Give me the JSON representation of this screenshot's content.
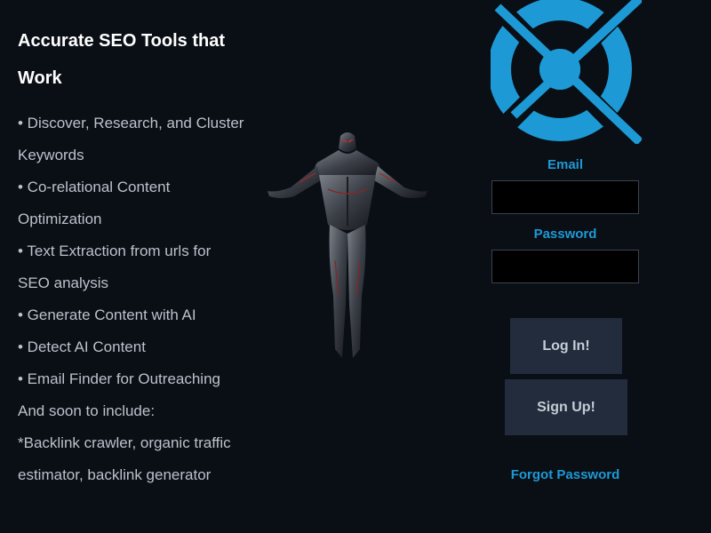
{
  "headline": "Accurate SEO Tools that Work",
  "features": [
    "• Discover, Research, and Cluster Keywords",
    "• Co-relational Content Optimization",
    "• Text Extraction from urls for SEO analysis",
    "• Generate Content with AI",
    "• Detect AI Content",
    "• Email Finder for Outreaching",
    "And soon to include:",
    "*Backlink crawler, organic traffic estimator, backlink generator"
  ],
  "login": {
    "email_label": "Email",
    "email_value": "",
    "password_label": "Password",
    "password_value": "",
    "login_button": "Log In!",
    "signup_button": "Sign Up!",
    "forgot_link": "Forgot Password"
  },
  "colors": {
    "background": "#0a0e15",
    "accent": "#1d9ad6",
    "button_bg": "#222c3d",
    "feature_text": "#bcc1cc"
  },
  "icons": {
    "logo": "circle-q-logo",
    "hero": "flying-armored-figure"
  }
}
